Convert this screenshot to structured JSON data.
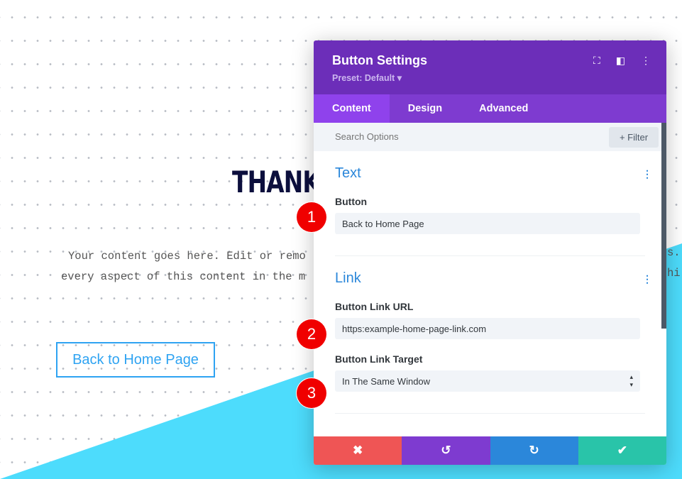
{
  "page": {
    "title": "THANK",
    "body_line1": "Your content goes here. Edit or remo",
    "body_line2": "every aspect of this content in the m",
    "body_right1": "s.",
    "body_right2": "hi",
    "button": "Back to Home Page"
  },
  "panel": {
    "title": "Button Settings",
    "preset": "Preset: Default ▾",
    "tabs": [
      "Content",
      "Design",
      "Advanced"
    ],
    "search_placeholder": "Search Options",
    "filter": "+ Filter",
    "sections": {
      "text": {
        "title": "Text",
        "button_label": "Button",
        "button_value": "Back to Home Page"
      },
      "link": {
        "title": "Link",
        "url_label": "Button Link URL",
        "url_value": "https:example-home-page-link.com",
        "target_label": "Button Link Target",
        "target_value": "In The Same Window"
      }
    },
    "footer_icons": [
      "close-icon",
      "undo-icon",
      "redo-icon",
      "check-icon"
    ]
  },
  "badges": [
    "1",
    "2",
    "3"
  ],
  "colors": {
    "header": "#6c2eb9",
    "tabs": "#7e3bd0",
    "active_tab": "#8f42ec",
    "accent": "#2b87da",
    "cancel": "#ef5555",
    "undo": "#7e3bd0",
    "redo": "#2b87da",
    "save": "#29c4a9",
    "cyan": "#4ddcfc"
  }
}
